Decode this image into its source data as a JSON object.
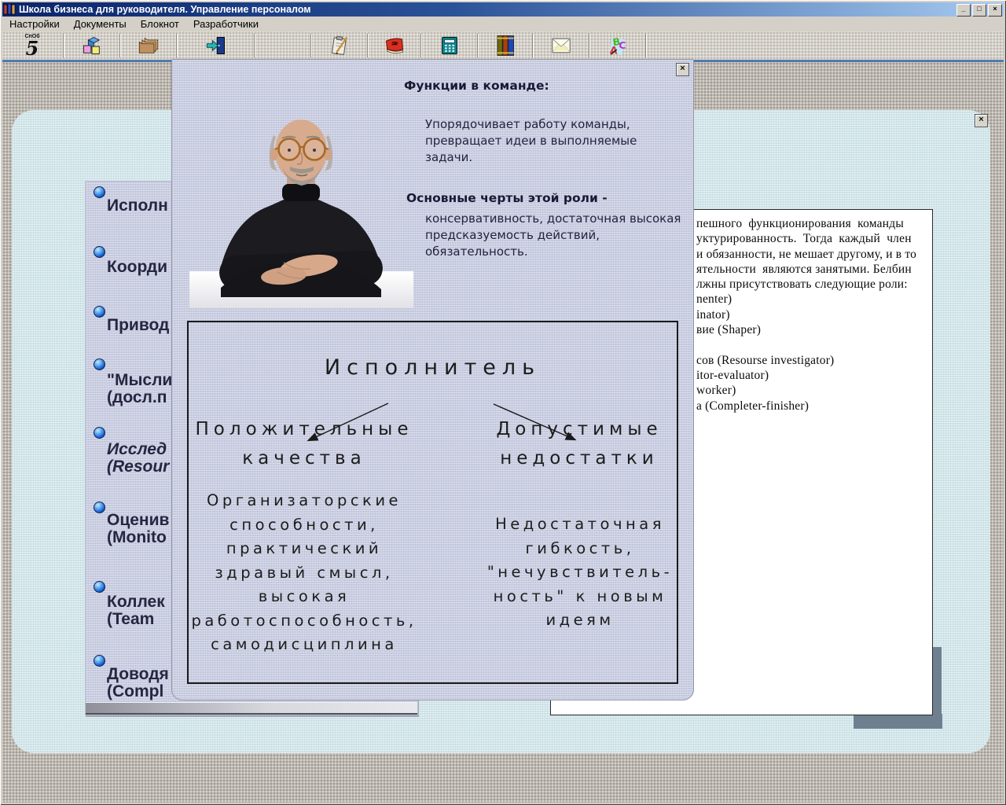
{
  "window": {
    "title": "Школа бизнеса для руководителя. Управление персоналом",
    "minimize_label": "_",
    "maximize_label": "□",
    "close_label": "×"
  },
  "menu": {
    "items": [
      "Настройки",
      "Документы",
      "Блокнот",
      "Разработчики"
    ]
  },
  "toolbar": {
    "logo_text": "СпОб",
    "logo_glyph": "5",
    "icons": [
      "school-logo",
      "blocks",
      "folders",
      "exit-door",
      "clipboard",
      "red-book",
      "calculator",
      "books",
      "mail",
      "abc-letters"
    ]
  },
  "main_panel": {
    "close_label": "×"
  },
  "role_list": {
    "items": [
      {
        "text": "Исполн"
      },
      {
        "text": "Коорди"
      },
      {
        "text": "Привод"
      },
      {
        "text": "\"Мысли\n(досл.п"
      },
      {
        "text": "Исслед\n(Resour"
      },
      {
        "text": "Оценив\n(Monito"
      },
      {
        "text": "Коллек\n(Team"
      },
      {
        "text": "Доводя\n(Compl"
      }
    ]
  },
  "document": {
    "text": "пешного  функционирования  команды\nуктурированность.  Тогда  каждый  член\nи обязанности, не мешает другому, и в то\nятельности  являются занятыми. Белбин\nлжны присутствовать следующие роли:\nnenter)\ninator)\nвие (Shaper)\n\nсов (Resourse investigator)\nitor-evaluator)\nworker)\nа (Completer-finisher)"
  },
  "popup": {
    "close_label": "×",
    "photo": "portrait-of-man-in-black-turtleneck-at-white-table",
    "functions_heading": "Функции в команде:",
    "functions_text": "Упорядочивает работу команды, превращает идеи в выполняемые задачи.",
    "traits_heading": "Основные черты этой роли -",
    "traits_text": "консервативность, достаточная высокая предсказуемость действий, обязательность.",
    "diagram": {
      "title": "Исполнитель",
      "left_heading": "Положительные\nкачества",
      "right_heading": "Допустимые\nнедостатки",
      "left_body": "Организаторские\nспособности,\nпрактический\nздравый смысл,\nвысокая\nработоспособность,\nсамодисциплина",
      "right_body": "Недостаточная\nгибкость,\n\"нечувствитель-\nность\" к новым\nидеям"
    }
  },
  "colors": {
    "titlebar_start": "#0a246a",
    "titlebar_end": "#a6caf0",
    "chrome": "#d4d0c8",
    "desktop": "#bdb8b0",
    "panel_blue": "#d3e6ea",
    "panel_lavender": "#c9cde1",
    "page_shadow": "#6e8090",
    "bullet_blue": "#1257c8"
  }
}
